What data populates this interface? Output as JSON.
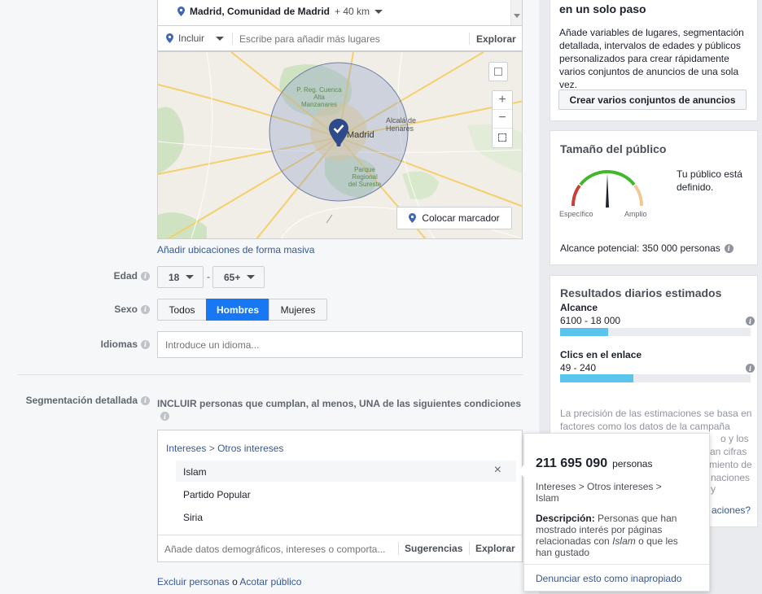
{
  "location": {
    "selected": "Madrid, Comunidad de Madrid",
    "radius": "+ 40 km",
    "include_label": "Incluir",
    "search_placeholder": "Escribe para añadir más lugares",
    "explore": "Explorar",
    "map_place_labels": [
      "Madrid",
      "Alcalá de Henares",
      "P. Reg. Cuenca Alta Manzanares",
      "Parque Regional del Sureste"
    ],
    "drop_pin": "Colocar marcador",
    "bulk_add": "Añadir ubicaciones de forma masiva"
  },
  "age": {
    "label": "Edad",
    "min": "18",
    "separator": "-",
    "max": "65+"
  },
  "gender": {
    "label": "Sexo",
    "options": [
      "Todos",
      "Hombres",
      "Mujeres"
    ],
    "selected": "Hombres"
  },
  "languages": {
    "label": "Idiomas",
    "placeholder": "Introduce un idioma..."
  },
  "detailed_targeting": {
    "label": "Segmentación detallada",
    "condition": "INCLUIR personas que cumplan, al menos, UNA de las siguientes condiciones",
    "breadcrumb": {
      "parent": "Intereses",
      "sep": ">",
      "child": "Otros intereses"
    },
    "items": [
      "Islam",
      "Partido Popular",
      "Siria"
    ],
    "add_placeholder": "Añade datos demográficos, intereses o comporta...",
    "suggestions": "Sugerencias",
    "explore": "Explorar",
    "exclude": "Excluir personas",
    "or": "o",
    "narrow": "Acotar público"
  },
  "tooltip": {
    "count": "211 695 090",
    "unit": "personas",
    "path": "Intereses > Otros intereses > Islam",
    "desc_label": "Descripción:",
    "desc_1": "Personas que han mostrado interés por páginas relacionadas con",
    "desc_em": "Islam",
    "desc_2": "o que les han gustado",
    "report": "Denunciar esto como inapropiado"
  },
  "promo": {
    "title": "en un solo paso",
    "text": "Añade variables de lugares, segmentación detallada, intervalos de edades y públicos personalizados para crear rápidamente varios conjuntos de anuncios de una sola vez.",
    "button": "Crear varios conjuntos de anuncios"
  },
  "audience": {
    "title": "Tamaño del público",
    "status": "Tu público está definido.",
    "specific": "Específico",
    "broad": "Amplio",
    "potential_reach": "Alcance potencial: 350 000 personas",
    "gauge_level": 0.5
  },
  "daily": {
    "title": "Resultados diarios estimados",
    "reach_label": "Alcance",
    "reach_value": "6100 - 18 000",
    "reach_fill": 0.25,
    "clicks_label": "Clics en el enlace",
    "clicks_value": "49 - 240",
    "clicks_fill": 0.385,
    "note": "La precisión de las estimaciones se basa en factores como los datos de la campaña",
    "note_frag": [
      "o y los",
      "an cifras",
      "miento de",
      "naciones y",
      "aciones?"
    ]
  },
  "colors": {
    "accent": "#1877f2",
    "selected_toggle": "#1877f2",
    "bar": "#5bc4ed",
    "link": "#365899"
  }
}
